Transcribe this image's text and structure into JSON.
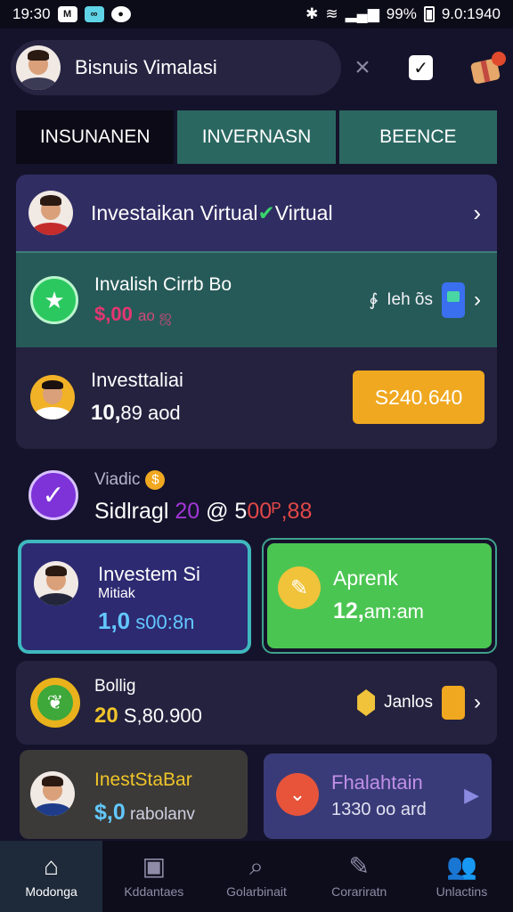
{
  "status_bar": {
    "time": "19:30",
    "battery": "99%",
    "clock": "9.0:1940"
  },
  "header": {
    "profile_name": "Bisnuis Vimalasi"
  },
  "tabs": [
    {
      "label": "INSUNANEN"
    },
    {
      "label": "INVERNASN"
    },
    {
      "label": "BEENCE"
    }
  ],
  "card_title": {
    "text": "Investaikan Virtual",
    "suffix": "Virtual",
    "check": "✔"
  },
  "card_green": {
    "title": "Invalish Cirrb Bo",
    "amount": "$,00",
    "amount_small": "ao ஜ",
    "right_text": "Ieh õs",
    "right_symbol": "∲"
  },
  "card_yellow": {
    "title": "Investtaliai",
    "amount": "10,",
    "amount_rest": "89 aod",
    "button": "S240.640"
  },
  "wallet": {
    "label": "Viadic",
    "coin": "$",
    "amount_prefix": "Sidlragl",
    "amount_purple": "20",
    "amount_rest": " @ 5",
    "amount_red": "00ᴾ,88"
  },
  "card_invest": {
    "title": "Investem Si",
    "subtitle": "Mitiak",
    "amount": "1,0",
    "amount_rest": " s00:8n"
  },
  "card_aprenk": {
    "title": "Aprenk",
    "amount": "12,",
    "amount_rest": "am:am"
  },
  "row_bonus": {
    "title": "Bollig",
    "amount": "20",
    "amount_rest": " S,80.900",
    "right_text": "Janlos"
  },
  "card_insest": {
    "title": "InestStaBar",
    "amount": "$,0",
    "amount_rest": " rabolanv"
  },
  "card_fhalan": {
    "title": "Fhalahtain",
    "subtitle": "1330 oo ard"
  },
  "nav": [
    {
      "label": "Modonga",
      "icon": "⌂"
    },
    {
      "label": "Kddantaes",
      "icon": "▣"
    },
    {
      "label": "Golarbinait",
      "icon": "⌕"
    },
    {
      "label": "Corariratn",
      "icon": "✎"
    },
    {
      "label": "Unlactins",
      "icon": "👥"
    }
  ]
}
